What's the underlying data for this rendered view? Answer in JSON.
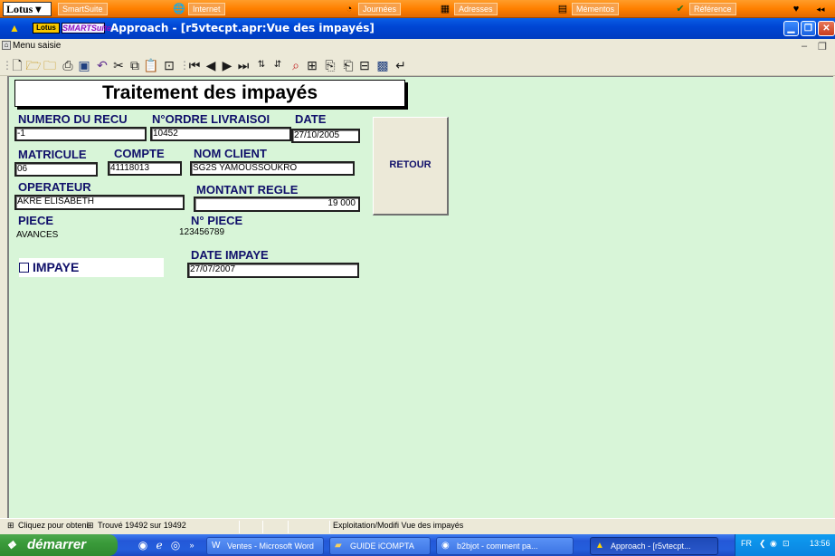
{
  "smartsuite_bar": {
    "lotus_label": "Lotus",
    "tabs": [
      "SmartSuite",
      "Internet",
      "Journées",
      "Adresses",
      "Mémentos",
      "Référence"
    ]
  },
  "window": {
    "logo_lotus": "Lotus",
    "logo_smartsuite": "SMARTSuite",
    "title": "Approach - [r5vtecpt.apr:Vue des impayés]"
  },
  "menu": {
    "label": "Menu saisie"
  },
  "form": {
    "title": "Traitement des impayés",
    "labels": {
      "numero_recu": "NUMERO DU RECU",
      "ordre_livraison": "N°ORDRE LIVRAISOI",
      "date": "DATE",
      "matricule": "MATRICULE",
      "compte": "COMPTE",
      "nom_client": "NOM CLIENT",
      "operateur": "OPERATEUR",
      "montant_regle": "MONTANT REGLE",
      "piece": "PIECE",
      "n_piece": "N° PIECE",
      "date_impaye": "DATE IMPAYE",
      "impaye": "IMPAYE"
    },
    "values": {
      "numero_recu": "-1",
      "ordre_livraison": "10452",
      "date": "27/10/2005",
      "matricule": "06",
      "compte": "41118013",
      "nom_client": "SG2S YAMOUSSOUKRO",
      "operateur": "AKRE  ELISABETH",
      "montant_regle": "19 000",
      "piece": "AVANCES",
      "n_piece": "123456789",
      "date_impaye": "27/07/2007"
    },
    "retour_button": "RETOUR"
  },
  "status_bar": {
    "hint": "Cliquez pour obteni",
    "found": "Trouvé 19492 sur 19492",
    "view": "Exploitation/Modifi Vue des impayés"
  },
  "taskbar": {
    "start_label": "démarrer",
    "tasks": [
      "Ventes - Microsoft Word",
      "GUIDE iCOMPTA",
      "b2bjot - comment pa...",
      "Approach - [r5vtecpt..."
    ],
    "lang": "FR",
    "clock": "13:56"
  }
}
